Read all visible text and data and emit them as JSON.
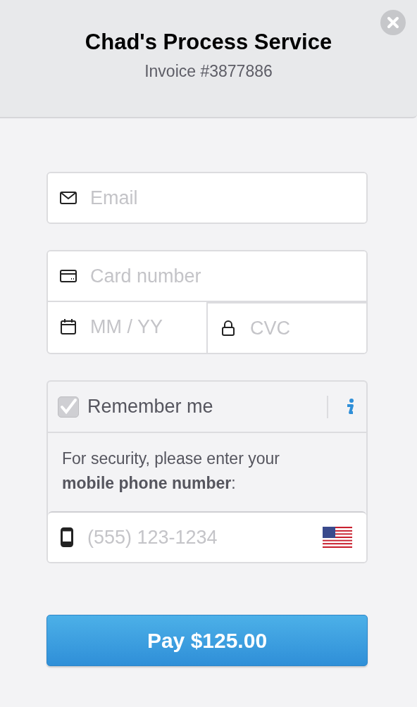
{
  "header": {
    "title": "Chad's Process Service",
    "subtitle": "Invoice #3877886"
  },
  "email": {
    "placeholder": "Email"
  },
  "card": {
    "number_placeholder": "Card number",
    "expiry_placeholder": "MM / YY",
    "cvc_placeholder": "CVC"
  },
  "remember": {
    "label": "Remember me",
    "checked": true,
    "note": "For security, please enter your **mobile phone number**:",
    "phone_placeholder": "(555) 123-1234"
  },
  "pay_button": "Pay $125.00"
}
